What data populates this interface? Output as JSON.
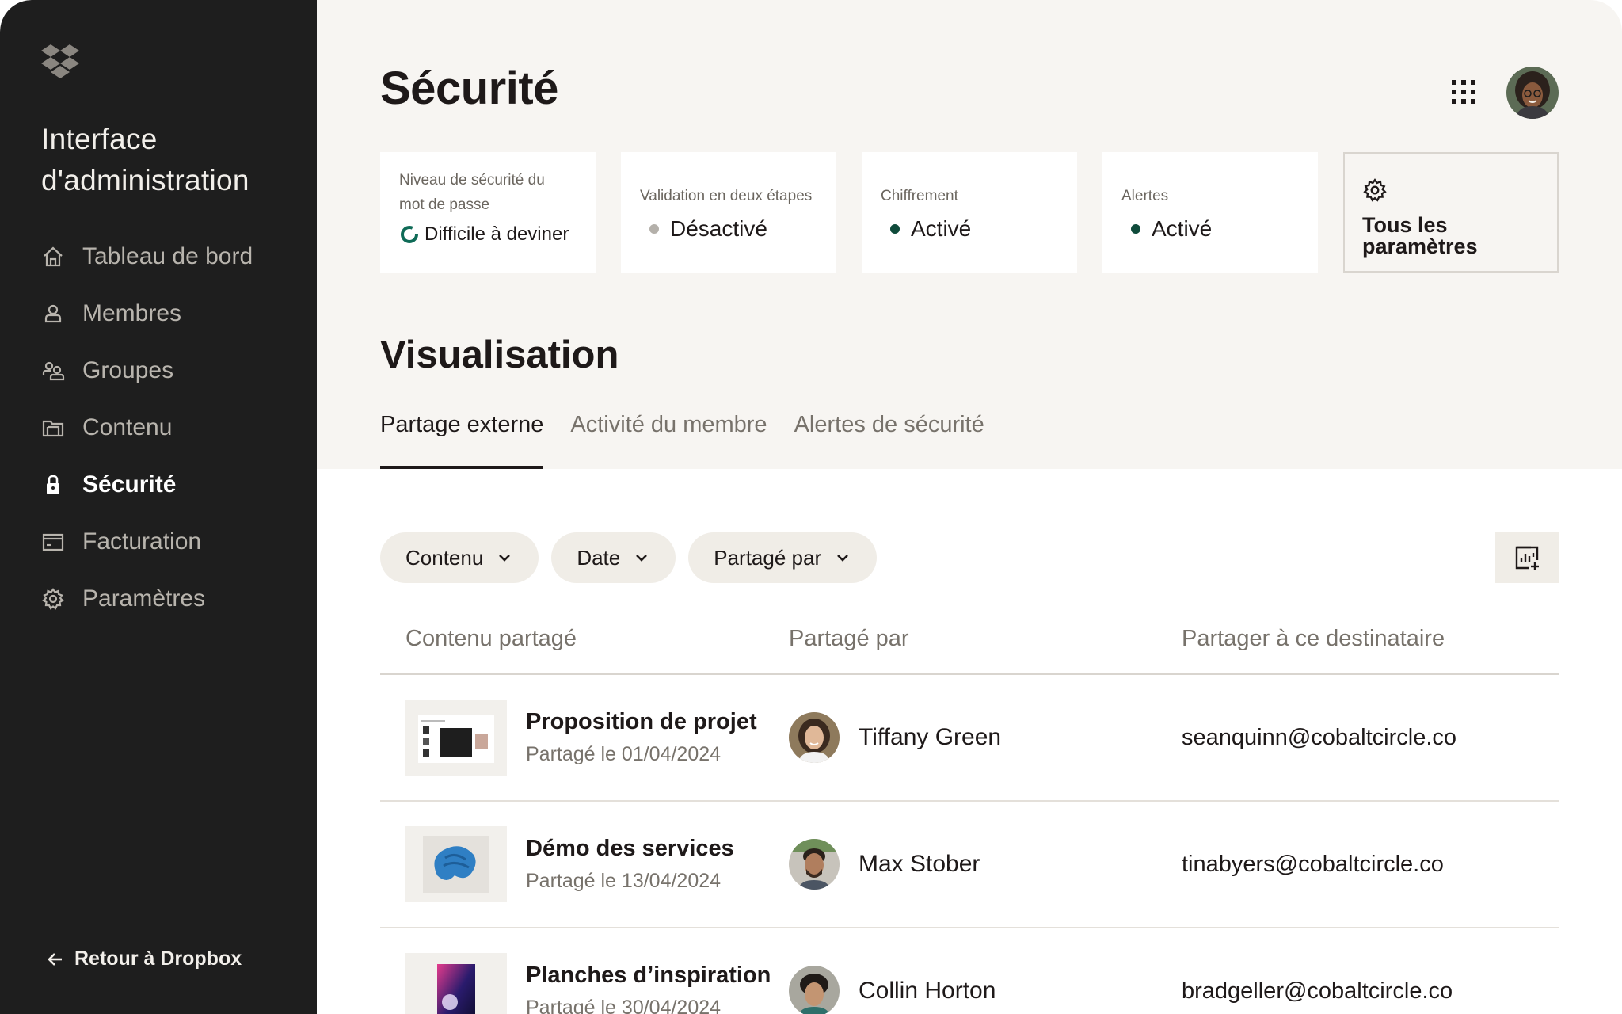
{
  "sidebar": {
    "title": "Interface d'administration",
    "items": [
      {
        "label": "Tableau de bord",
        "icon": "home-icon"
      },
      {
        "label": "Membres",
        "icon": "person-icon"
      },
      {
        "label": "Groupes",
        "icon": "group-icon"
      },
      {
        "label": "Contenu",
        "icon": "folder-icon"
      },
      {
        "label": "Sécurité",
        "icon": "lock-icon",
        "active": true
      },
      {
        "label": "Facturation",
        "icon": "card-icon"
      },
      {
        "label": "Paramètres",
        "icon": "gear-icon"
      }
    ],
    "back_label": "Retour à Dropbox"
  },
  "header": {
    "title": "Sécurité"
  },
  "cards": [
    {
      "label": "Niveau de sécurité du mot de passe",
      "value": "Difficile à deviner",
      "indicator": "ring",
      "color": "#0f6b57"
    },
    {
      "label": "Validation en deux étapes",
      "value": "Désactivé",
      "indicator": "dot",
      "color": "#b4b0aa"
    },
    {
      "label": "Chiffrement",
      "value": "Activé",
      "indicator": "dot",
      "color": "#0f4b3b"
    },
    {
      "label": "Alertes",
      "value": "Activé",
      "indicator": "dot",
      "color": "#0f4b3b"
    }
  ],
  "settings_card": {
    "label": "Tous les paramètres",
    "icon": "gear-icon"
  },
  "section": {
    "title": "Visualisation"
  },
  "tabs": [
    {
      "label": "Partage externe",
      "active": true
    },
    {
      "label": "Activité du membre"
    },
    {
      "label": "Alertes de sécurité"
    }
  ],
  "filters": [
    {
      "label": "Contenu"
    },
    {
      "label": "Date"
    },
    {
      "label": "Partagé par"
    }
  ],
  "table": {
    "columns": [
      "Contenu partagé",
      "Partagé par",
      "Partager à ce destinataire"
    ],
    "rows": [
      {
        "name": "Proposition de projet",
        "date": "Partagé le 01/04/2024",
        "person": "Tiffany Green",
        "recipient": "seanquinn@cobaltcircle.co"
      },
      {
        "name": "Démo des services",
        "date": "Partagé le 13/04/2024",
        "person": "Max Stober",
        "recipient": "tinabyers@cobaltcircle.co"
      },
      {
        "name": "Planches d’inspiration",
        "date": "Partagé le 30/04/2024",
        "person": "Collin Horton",
        "recipient": "bradgeller@cobaltcircle.co"
      }
    ]
  },
  "colors": {
    "sidebar_bg": "#1e1e1e",
    "page_bg": "#f7f5f2",
    "chip_bg": "#f0ede7",
    "text": "#1e1919",
    "muted": "#77726b"
  }
}
